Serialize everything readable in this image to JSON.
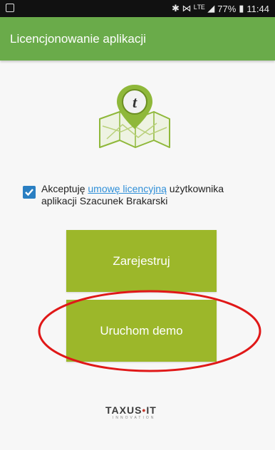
{
  "statusbar": {
    "indicators": "✱ ⋈ ᴸᵀᴱ ◢",
    "battery": "77%",
    "time": "11:44"
  },
  "appbar": {
    "title": "Licencjonowanie aplikacji"
  },
  "logo": {
    "letter": "t"
  },
  "license": {
    "checked": true,
    "text_before": "Akceptuję ",
    "link_text": "umowę licencyjną",
    "text_after": " użytkownika aplikacji Szacunek Brakarski"
  },
  "buttons": {
    "register_label": "Zarejestruj",
    "demo_label": "Uruchom demo"
  },
  "footer": {
    "brand_left": "TAXUS",
    "brand_dot": "•",
    "brand_right": "IT",
    "brand_sub": "INNOVATION"
  },
  "colors": {
    "appbar": "#6aab4a",
    "button": "#9cb72a",
    "link": "#2f8fd8",
    "annotation": "#e01818"
  }
}
